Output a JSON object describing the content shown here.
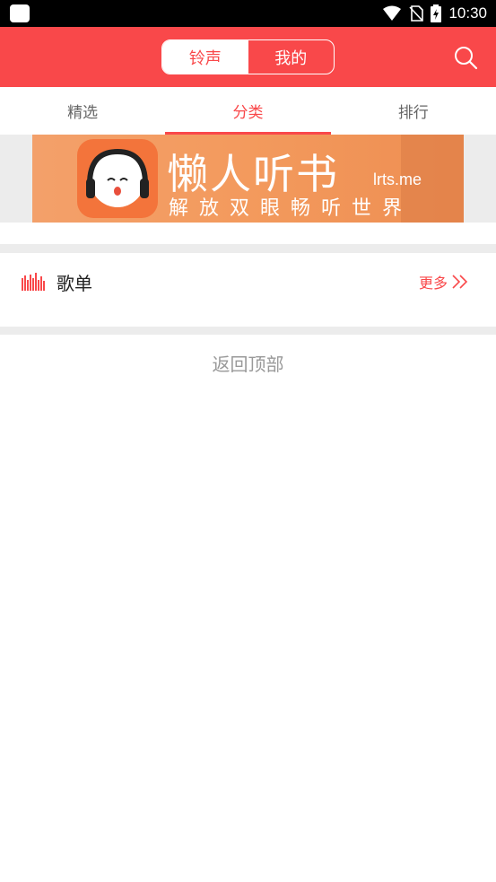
{
  "status_bar": {
    "time": "10:30"
  },
  "header": {
    "segments": [
      {
        "label": "铃声",
        "active": true
      },
      {
        "label": "我的",
        "active": false
      }
    ],
    "accent_color": "#f9484a"
  },
  "tabs": [
    {
      "label": "精选",
      "active": false
    },
    {
      "label": "分类",
      "active": true
    },
    {
      "label": "排行",
      "active": false
    }
  ],
  "banner": {
    "title": "懒人听书",
    "domain": "lrts.me",
    "subtitle": "解放双眼畅听世界"
  },
  "section": {
    "title": "歌单",
    "more_label": "更多"
  },
  "back_to_top": "返回顶部"
}
